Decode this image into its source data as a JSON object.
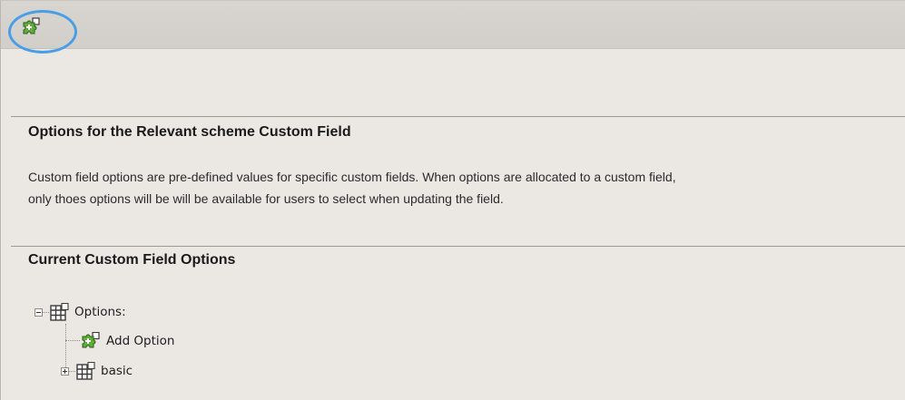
{
  "toolbar": {
    "add_button_icon": "add-puzzle-icon"
  },
  "options_section": {
    "title": "Options for the Relevant scheme Custom Field",
    "description_line1": "Custom field options are pre-defined values for specific custom fields. When options are allocated to a custom field,",
    "description_line2": "only thoes options will be will be available for users to select when updating the field."
  },
  "current_section": {
    "title": "Current Custom Field Options"
  },
  "tree": {
    "root_label": "Options:",
    "root_icon": "grid-table-icon",
    "children": [
      {
        "label": "Add Option",
        "icon": "add-puzzle-icon"
      },
      {
        "label": "basic",
        "icon": "grid-table-icon"
      }
    ]
  },
  "colors": {
    "highlight_ring": "#4a9ee6",
    "toolbar_bg": "#d4d1cc",
    "page_bg": "#ebe8e4"
  }
}
